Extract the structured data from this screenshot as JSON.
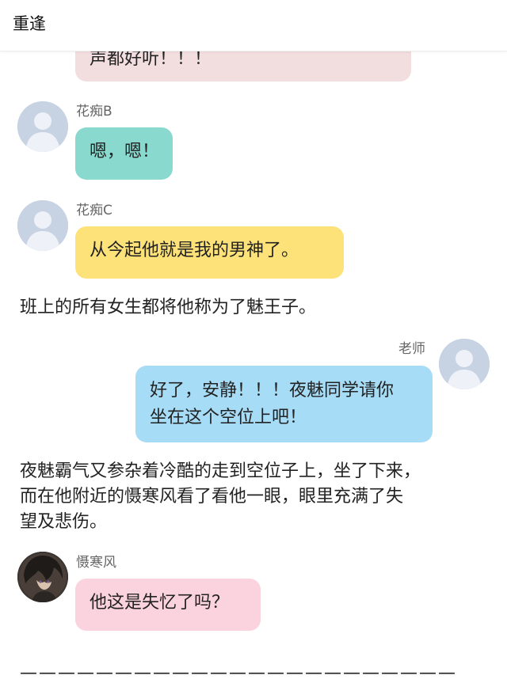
{
  "header": {
    "title": "重逢"
  },
  "colors": {
    "pink_light": "#f2dede",
    "teal": "#8ad9cf",
    "yellow": "#fde27a",
    "blue": "#a7dcf6",
    "pink": "#fbd3df",
    "avatar_bg": "#c7d3e3"
  },
  "messages": [
    {
      "text": "声都好听！！！"
    },
    {
      "sender": "花痴B",
      "text": "嗯，嗯！"
    },
    {
      "sender": "花痴C",
      "text": "从今起他就是我的男神了。"
    },
    {
      "narration": [
        "班上的所有女生都将他称为了魅王子。"
      ]
    },
    {
      "sender": "老师",
      "lines": [
        "好了，安静！！！夜魅同学请你",
        "坐在这个空位上吧！"
      ]
    },
    {
      "narration": [
        "夜魅霸气又参杂着冷酷的走到空位子上，坐了下来，",
        "而在他附近的慑寒风看了看他一眼，眼里充满了失",
        "望及悲伤。"
      ]
    },
    {
      "sender": "慑寒风",
      "text": "他这是失忆了吗？"
    }
  ],
  "divider": "———————————————————————"
}
